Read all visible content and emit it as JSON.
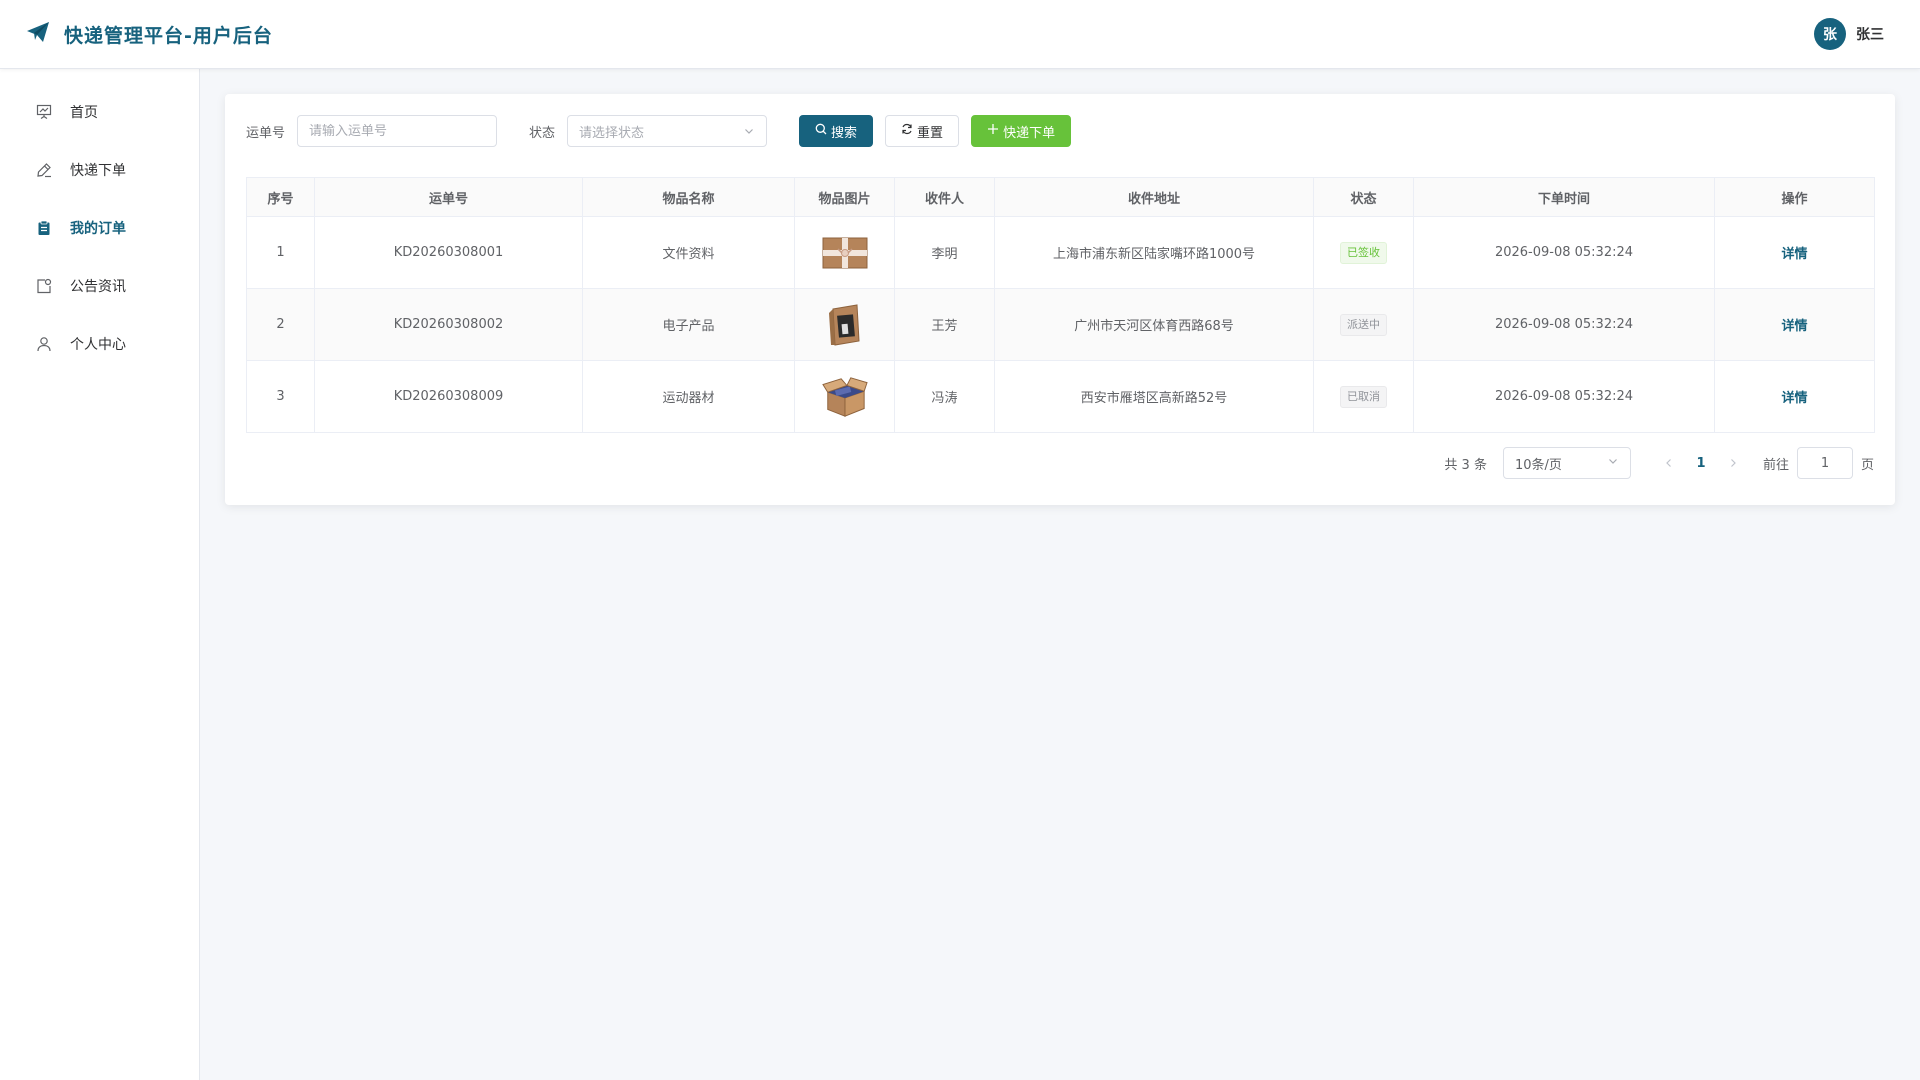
{
  "app": {
    "title": "快递管理平台-用户后台"
  },
  "user": {
    "avatar_char": "张",
    "name": "张三"
  },
  "colors": {
    "primary": "#17627e",
    "success": "#67c23a",
    "info": "#909399"
  },
  "sidebar": {
    "items": [
      {
        "label": "首页",
        "icon": "presentation-icon",
        "active": false
      },
      {
        "label": "快递下单",
        "icon": "pen-icon",
        "active": false
      },
      {
        "label": "我的订单",
        "icon": "clipboard-icon",
        "active": true
      },
      {
        "label": "公告资讯",
        "icon": "notice-icon",
        "active": false
      },
      {
        "label": "个人中心",
        "icon": "user-icon",
        "active": false
      }
    ]
  },
  "filters": {
    "tracking_label": "运单号",
    "tracking_placeholder": "请输入运单号",
    "tracking_value": "",
    "status_label": "状态",
    "status_placeholder": "请选择状态",
    "search_label": "搜索",
    "reset_label": "重置",
    "create_label": "快递下单"
  },
  "table": {
    "columns": [
      "序号",
      "运单号",
      "物品名称",
      "物品图片",
      "收件人",
      "收件地址",
      "状态",
      "下单时间",
      "操作"
    ],
    "rows": [
      {
        "index": "1",
        "tracking": "KD20260308001",
        "item": "文件资料",
        "image": "document-package-icon",
        "recipient": "李明",
        "address": "上海市浦东新区陆家嘴环路1000号",
        "status": "已签收",
        "status_type": "success",
        "time": "2026-09-08 05:32:24",
        "action": "详情"
      },
      {
        "index": "2",
        "tracking": "KD20260308002",
        "item": "电子产品",
        "image": "electronics-box-icon",
        "recipient": "王芳",
        "address": "广州市天河区体育西路68号",
        "status": "派送中",
        "status_type": "info",
        "time": "2026-09-08 05:32:24",
        "action": "详情"
      },
      {
        "index": "3",
        "tracking": "KD20260308009",
        "item": "运动器材",
        "image": "open-box-icon",
        "recipient": "冯涛",
        "address": "西安市雁塔区高新路52号",
        "status": "已取消",
        "status_type": "info",
        "time": "2026-09-08 05:32:24",
        "action": "详情"
      }
    ]
  },
  "pagination": {
    "total_text": "共 3 条",
    "page_size": "10条/页",
    "current_page": "1",
    "goto_label": "前往",
    "goto_value": "1",
    "page_suffix": "页"
  }
}
